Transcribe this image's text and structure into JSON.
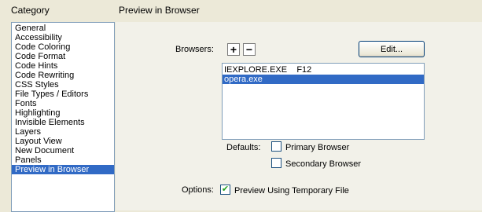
{
  "headers": {
    "category": "Category",
    "panel_title": "Preview in Browser"
  },
  "categories": [
    {
      "label": "General",
      "selected": false
    },
    {
      "label": "Accessibility",
      "selected": false
    },
    {
      "label": "Code Coloring",
      "selected": false
    },
    {
      "label": "Code Format",
      "selected": false
    },
    {
      "label": "Code Hints",
      "selected": false
    },
    {
      "label": "Code Rewriting",
      "selected": false
    },
    {
      "label": "CSS Styles",
      "selected": false
    },
    {
      "label": "File Types / Editors",
      "selected": false
    },
    {
      "label": "Fonts",
      "selected": false
    },
    {
      "label": "Highlighting",
      "selected": false
    },
    {
      "label": "Invisible Elements",
      "selected": false
    },
    {
      "label": "Layers",
      "selected": false
    },
    {
      "label": "Layout View",
      "selected": false
    },
    {
      "label": "New Document",
      "selected": false
    },
    {
      "label": "Panels",
      "selected": false
    },
    {
      "label": "Preview in Browser",
      "selected": true
    }
  ],
  "browsers": {
    "label": "Browsers:",
    "add_symbol": "+",
    "remove_symbol": "−",
    "edit_label": "Edit...",
    "items": [
      {
        "text": "IEXPLORE.EXE    F12",
        "selected": false
      },
      {
        "text": "opera.exe",
        "selected": true
      }
    ]
  },
  "defaults": {
    "label": "Defaults:",
    "primary_label": "Primary Browser",
    "primary_checked": false,
    "secondary_label": "Secondary Browser",
    "secondary_checked": false
  },
  "options": {
    "label": "Options:",
    "preview_temp_label": "Preview Using Temporary File",
    "preview_temp_checked": true
  },
  "colors": {
    "selection": "#316ac5",
    "dialog_bg": "#ece9d8",
    "checkmark": "#21a121"
  }
}
